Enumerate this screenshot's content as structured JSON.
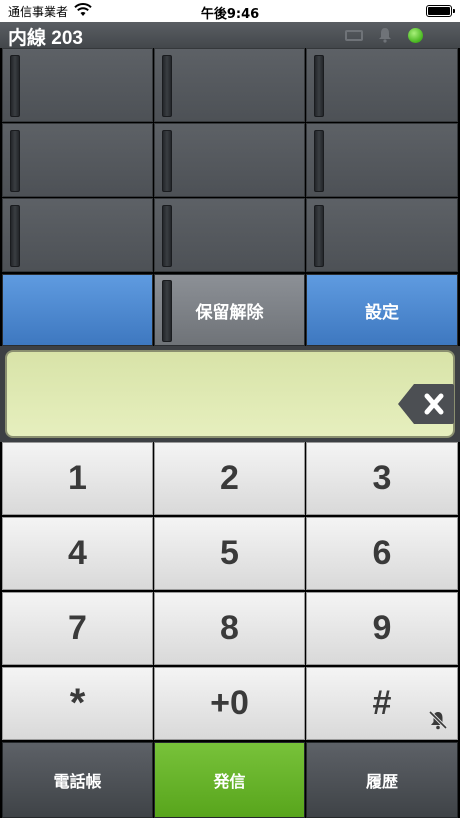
{
  "status_bar": {
    "carrier": "通信事業者",
    "time": "午後9:46"
  },
  "header": {
    "title": "内線 203",
    "status_color": "#46b51e"
  },
  "line_keys": [
    "",
    "",
    "",
    "",
    "",
    "",
    "",
    "",
    ""
  ],
  "function_keys": {
    "left": "",
    "hold_release": "保留解除",
    "settings": "設定"
  },
  "display": {
    "number": ""
  },
  "keypad": [
    "1",
    "2",
    "3",
    "4",
    "5",
    "6",
    "7",
    "8",
    "9",
    "*",
    "+0",
    "#"
  ],
  "actions": {
    "phonebook": "電話帳",
    "call": "発信",
    "history": "履歴"
  },
  "colors": {
    "accent_blue": "#4a86cf",
    "call_green": "#6ab52c",
    "display_bg": "#e1eab6"
  }
}
